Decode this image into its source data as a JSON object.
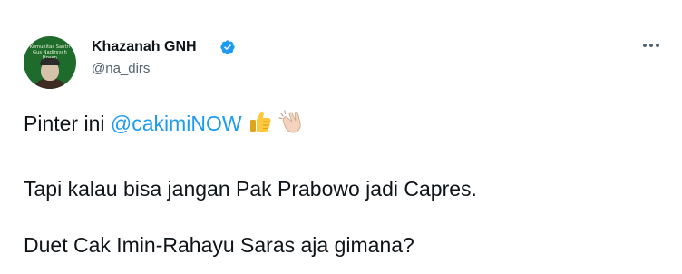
{
  "author": {
    "display_name": "Khazanah GNH",
    "handle": "@na_dirs",
    "avatar_text": "Komunitas Santri Gus Nadirsyah Hosen"
  },
  "icons": {
    "verified": "verified-badge-icon",
    "more": "more-options-icon",
    "thumbs_up": "thumbs-up-emoji",
    "clap": "clapping-hands-emoji"
  },
  "colors": {
    "mention": "#1d9bf0",
    "text": "#0f1419",
    "secondary": "#536471"
  },
  "tweet": {
    "line1_prefix": "Pinter ini ",
    "mention": "@cakimiNOW",
    "line2": "Tapi kalau bisa jangan Pak Prabowo jadi Capres.",
    "line3": "Duet Cak Imin-Rahayu Saras aja gimana?"
  }
}
